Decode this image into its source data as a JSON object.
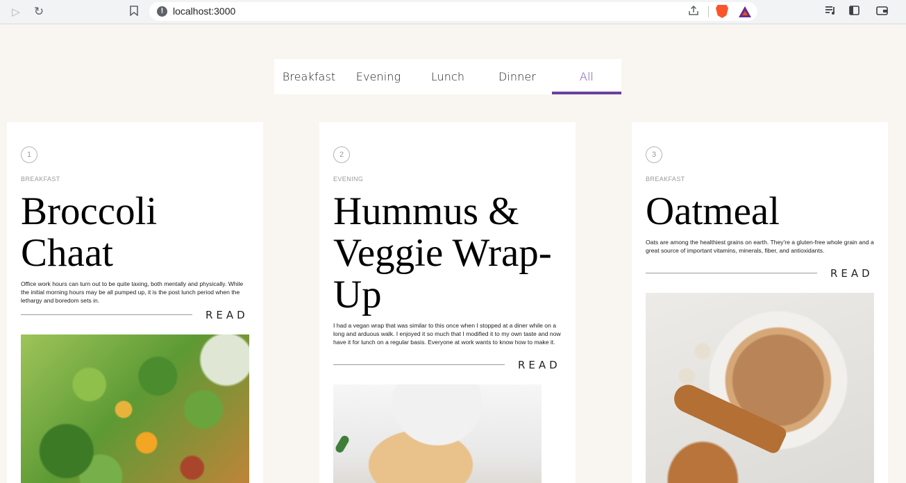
{
  "browser": {
    "url": "localhost:3000",
    "info_glyph": "!",
    "icons": [
      "play-icon",
      "reload-icon",
      "bookmark-icon",
      "share-icon",
      "brave-shield-icon",
      "brave-rewards-icon",
      "media-queue-icon",
      "sidebar-icon",
      "wallet-icon"
    ]
  },
  "tabs": [
    {
      "label": "Breakfast",
      "active": false
    },
    {
      "label": "Evening",
      "active": false
    },
    {
      "label": "Lunch",
      "active": false
    },
    {
      "label": "Dinner",
      "active": false
    },
    {
      "label": "All",
      "active": true
    }
  ],
  "accent_color": "#6b3fa0",
  "background_color": "#f9f6f1",
  "cards": [
    {
      "number": "1",
      "category": "BREAKFAST",
      "title": "Broccoli Chaat",
      "description": "Office work hours can turn out to be quite taxing, both mentally and physically. While the initial morning hours may be all pumped up, it is the post lunch period when the lethargy and boredom sets in.",
      "read_label": "READ",
      "image": "broccoli-salad-image"
    },
    {
      "number": "2",
      "category": "EVENING",
      "title": "Hummus & Veggie Wrap-Up",
      "description": "I had a vegan wrap that was similar to this once when I stopped at a diner while on a long and arduous walk. I enjoyed it so much that I modified it to my own taste and now have it for lunch on a regular basis. Everyone at work wants to know how to make it.",
      "read_label": "READ",
      "image": "veggie-wrap-image"
    },
    {
      "number": "3",
      "category": "BREAKFAST",
      "title": "Oatmeal",
      "description": "Oats are among the healthiest grains on earth. They're a gluten-free whole grain and a great source of important vitamins, minerals, fiber, and antioxidants.",
      "read_label": "READ",
      "image": "oatmeal-bowl-image"
    }
  ]
}
